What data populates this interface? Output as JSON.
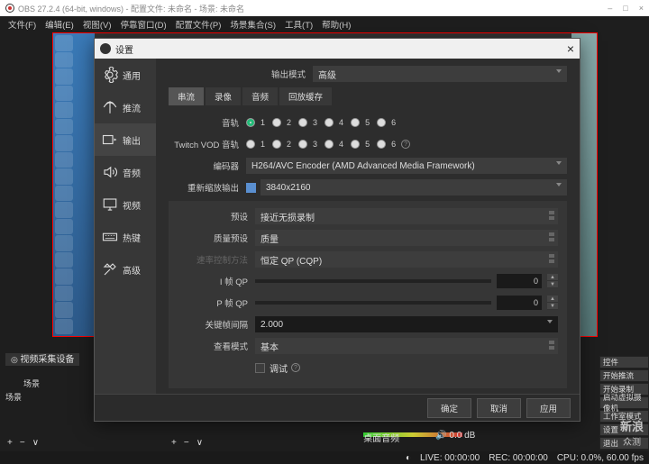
{
  "window": {
    "title": "OBS 27.2.4 (64-bit, windows) - 配置文件: 未命名 - 场景: 未命名"
  },
  "menu": [
    "文件(F)",
    "编辑(E)",
    "视图(V)",
    "停靠窗口(D)",
    "配置文件(P)",
    "场景集合(S)",
    "工具(T)",
    "帮助(H)"
  ],
  "dialog": {
    "title": "设置",
    "sidebar": [
      {
        "label": "通用",
        "icon": "gear"
      },
      {
        "label": "推流",
        "icon": "antenna"
      },
      {
        "label": "输出",
        "icon": "output"
      },
      {
        "label": "音频",
        "icon": "speaker"
      },
      {
        "label": "视频",
        "icon": "monitor"
      },
      {
        "label": "热键",
        "icon": "keyboard"
      },
      {
        "label": "高级",
        "icon": "tools"
      }
    ],
    "output_mode_label": "输出模式",
    "output_mode_value": "高级",
    "tabs": [
      "串流",
      "录像",
      "音频",
      "回放缓存"
    ],
    "fields": {
      "tracks_label": "音轨",
      "twitch_label": "Twitch VOD 音轨",
      "encoder_label": "编码器",
      "encoder_value": "H264/AVC Encoder (AMD Advanced Media Framework)",
      "rescale_label": "重新缩放输出",
      "rescale_value": "3840x2160",
      "preset_label": "预设",
      "preset_value": "接近无损录制",
      "quality_pref_label": "质量预设",
      "quality_pref_value": "质量",
      "rate_control_label": "速率控制方法",
      "rate_control_value": "恒定 QP (CQP)",
      "iframe_label": "I 帧 QP",
      "iframe_value": "0",
      "pframe_label": "P 帧 QP",
      "pframe_value": "0",
      "keyint_label": "关键帧间隔",
      "keyint_value": "2.000",
      "view_mode_label": "查看模式",
      "view_mode_value": "基本",
      "debug_label": "调试"
    },
    "buttons": {
      "ok": "确定",
      "cancel": "取消",
      "apply": "应用"
    }
  },
  "right_buttons": [
    "控件",
    "开始推流",
    "开始录制",
    "启动虚拟摄像机",
    "工作室模式",
    "设置",
    "退出"
  ],
  "bottom": {
    "source_tab": "视频采集设备",
    "scene_label": "场景",
    "audio_label": "桌面音频",
    "db": "0.0 dB"
  },
  "status": {
    "live": "LIVE: 00:00:00",
    "rec": "REC: 00:00:00",
    "cpu": "CPU: 0.0%, 60.00 fps"
  },
  "watermark": {
    "line1": "新浪",
    "line2": "众测"
  }
}
